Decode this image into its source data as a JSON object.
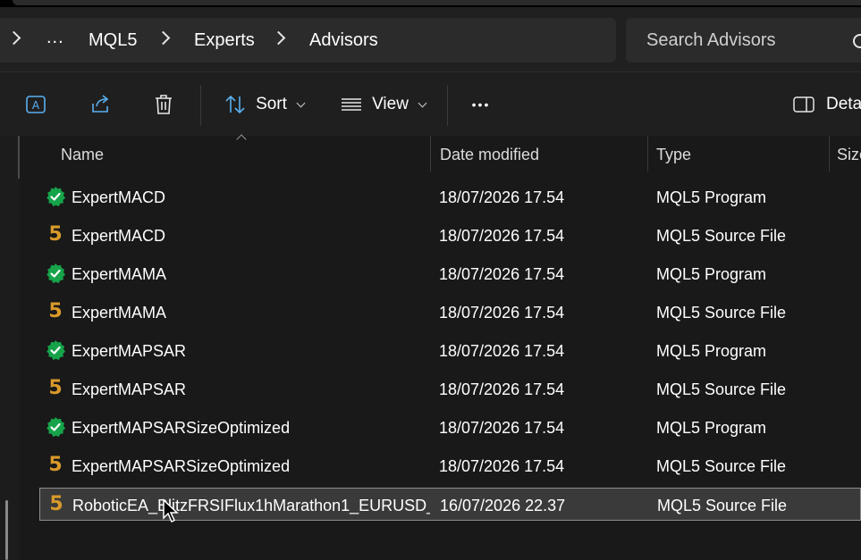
{
  "breadcrumb": {
    "overflow": "...",
    "items": [
      "MQL5",
      "Experts",
      "Advisors"
    ]
  },
  "search": {
    "placeholder": "Search Advisors"
  },
  "toolbar": {
    "sort_label": "Sort",
    "view_label": "View",
    "more_label": "•••",
    "details_label": "Deta"
  },
  "columns": {
    "name": "Name",
    "date": "Date modified",
    "type": "Type",
    "size": "Size"
  },
  "files": [
    {
      "name": "ExpertMACD",
      "date": "18/07/2026 17.54",
      "type": "MQL5 Program",
      "icon": "program-icon"
    },
    {
      "name": "ExpertMACD",
      "date": "18/07/2026 17.54",
      "type": "MQL5 Source File",
      "icon": "source-icon"
    },
    {
      "name": "ExpertMAMA",
      "date": "18/07/2026 17.54",
      "type": "MQL5 Program",
      "icon": "program-icon"
    },
    {
      "name": "ExpertMAMA",
      "date": "18/07/2026 17.54",
      "type": "MQL5 Source File",
      "icon": "source-icon"
    },
    {
      "name": "ExpertMAPSAR",
      "date": "18/07/2026 17.54",
      "type": "MQL5 Program",
      "icon": "program-icon"
    },
    {
      "name": "ExpertMAPSAR",
      "date": "18/07/2026 17.54",
      "type": "MQL5 Source File",
      "icon": "source-icon"
    },
    {
      "name": "ExpertMAPSARSizeOptimized",
      "date": "18/07/2026 17.54",
      "type": "MQL5 Program",
      "icon": "program-icon"
    },
    {
      "name": "ExpertMAPSARSizeOptimized",
      "date": "18/07/2026 17.54",
      "type": "MQL5 Source File",
      "icon": "source-icon"
    },
    {
      "name": "RoboticEA_BlitzFRSIFlux1hMarathon1_EURUSD_...",
      "date": "16/07/2026 22.37",
      "type": "MQL5 Source File",
      "icon": "source-icon",
      "selected": true
    }
  ],
  "icons": {
    "source_glyph": "5",
    "program_color": "#16a34a",
    "source_color": "#d89a2a"
  }
}
